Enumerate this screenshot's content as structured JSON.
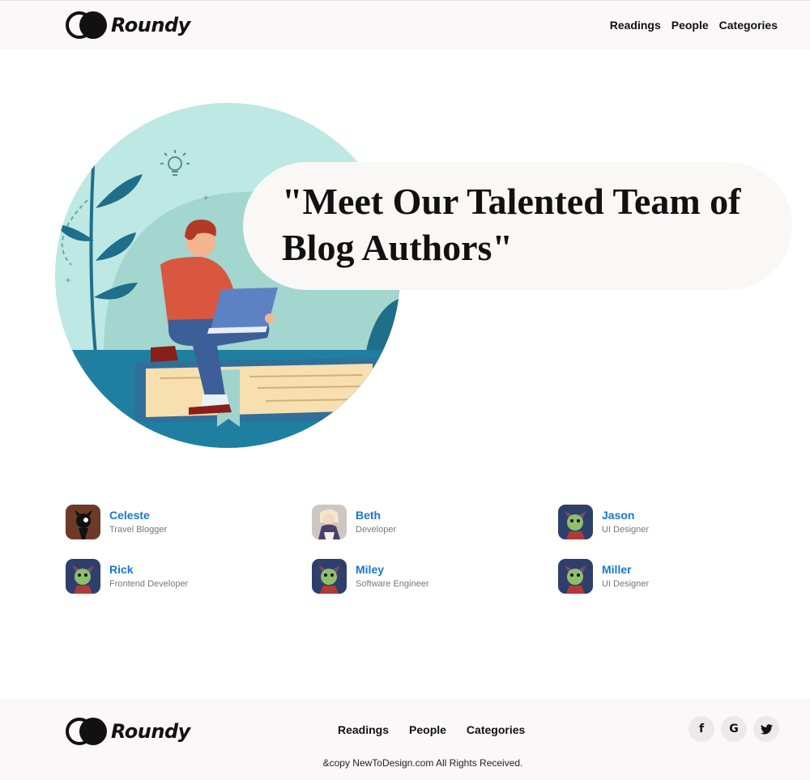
{
  "brand": {
    "name": "Roundy"
  },
  "nav": {
    "readings": "Readings",
    "people": "People",
    "categories": "Categories"
  },
  "hero": {
    "title": "\"Meet Our Talented Team of Blog Authors\""
  },
  "authors": [
    {
      "name": "Celeste",
      "role": "Travel Blogger"
    },
    {
      "name": "Beth",
      "role": "Developer"
    },
    {
      "name": "Jason",
      "role": "UI Designer"
    },
    {
      "name": "Rick",
      "role": "Frontend Developer"
    },
    {
      "name": "Miley",
      "role": "Software Engineer"
    },
    {
      "name": "Miller",
      "role": "UI Designer"
    }
  ],
  "footer": {
    "nav": {
      "readings": "Readings",
      "people": "People",
      "categories": "Categories"
    },
    "social": {
      "facebook": "f",
      "google": "G",
      "twitter": "twitter-bird"
    },
    "copyright": "&copy NewToDesign.com All Rights Received."
  },
  "colors": {
    "accent": "#1b75d0",
    "header_bg": "#faf8f8",
    "hero_teal": "#bde8e3"
  }
}
